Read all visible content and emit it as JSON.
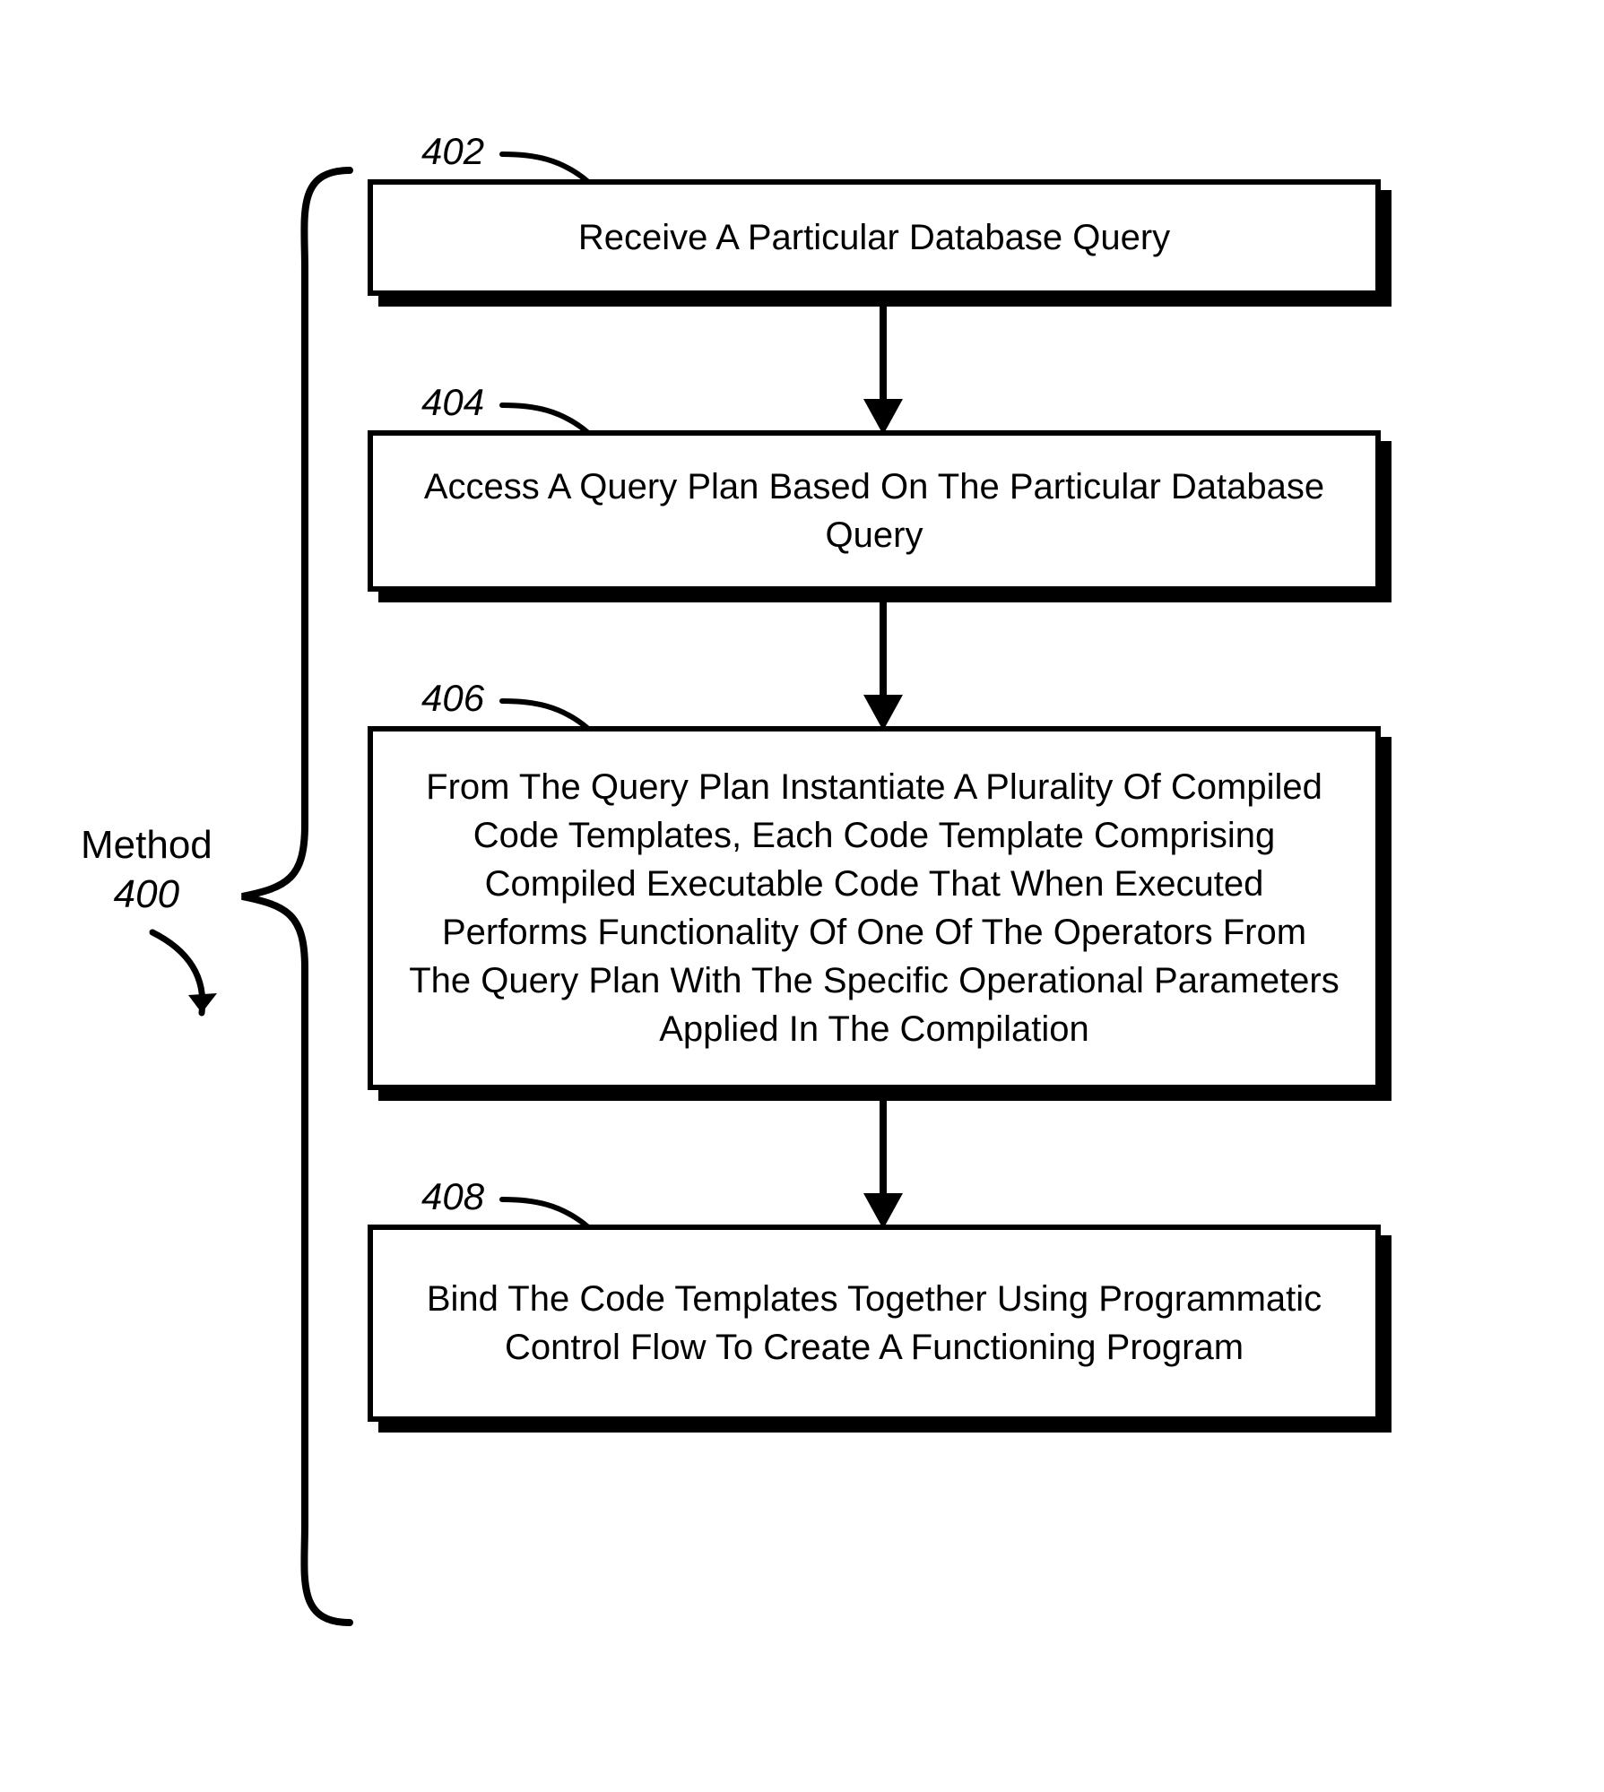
{
  "method": {
    "title": "Method",
    "number": "400"
  },
  "steps": [
    {
      "num": "402",
      "text": "Receive A Particular Database Query"
    },
    {
      "num": "404",
      "text": "Access A Query Plan Based On The Particular Database Query"
    },
    {
      "num": "406",
      "text": "From The Query Plan Instantiate A Plurality Of Compiled Code Templates, Each Code Template Comprising Compiled Executable Code That When Executed Performs Functionality Of One Of The Operators From The Query Plan With The Specific Operational Parameters Applied In The Compilation"
    },
    {
      "num": "408",
      "text": "Bind The Code Templates Together Using Programmatic Control Flow To Create A Functioning Program"
    }
  ]
}
